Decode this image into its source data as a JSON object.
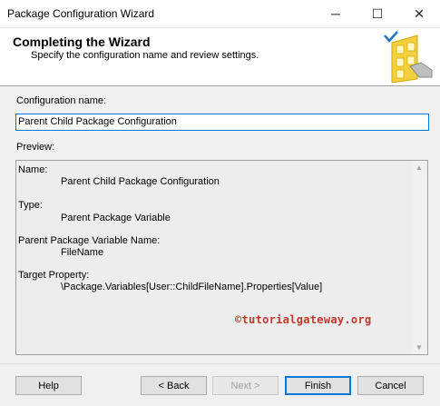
{
  "window": {
    "title": "Package Configuration Wizard",
    "minimize": "─",
    "maximize": "☐",
    "close": "✕"
  },
  "header": {
    "title": "Completing the Wizard",
    "subtitle": "Specify the configuration name and review settings.",
    "icon": "wizard-checkmark-graphic"
  },
  "form": {
    "config_name_label": "Configuration name:",
    "config_name_value": "Parent Child Package Configuration",
    "preview_label": "Preview:"
  },
  "preview": {
    "name_label": "Name:",
    "name_value": "Parent Child Package Configuration",
    "type_label": "Type:",
    "type_value": "Parent Package Variable",
    "parent_var_label": "Parent Package Variable Name:",
    "parent_var_value": "FileName",
    "target_label": "Target Property:",
    "target_value": "\\Package.Variables[User::ChildFileName].Properties[Value]"
  },
  "watermark": "©tutorialgateway.org",
  "buttons": {
    "help": "Help",
    "back": "< Back",
    "next": "Next >",
    "finish": "Finish",
    "cancel": "Cancel"
  },
  "colors": {
    "accent": "#0078d7",
    "watermark": "#c0392b"
  }
}
